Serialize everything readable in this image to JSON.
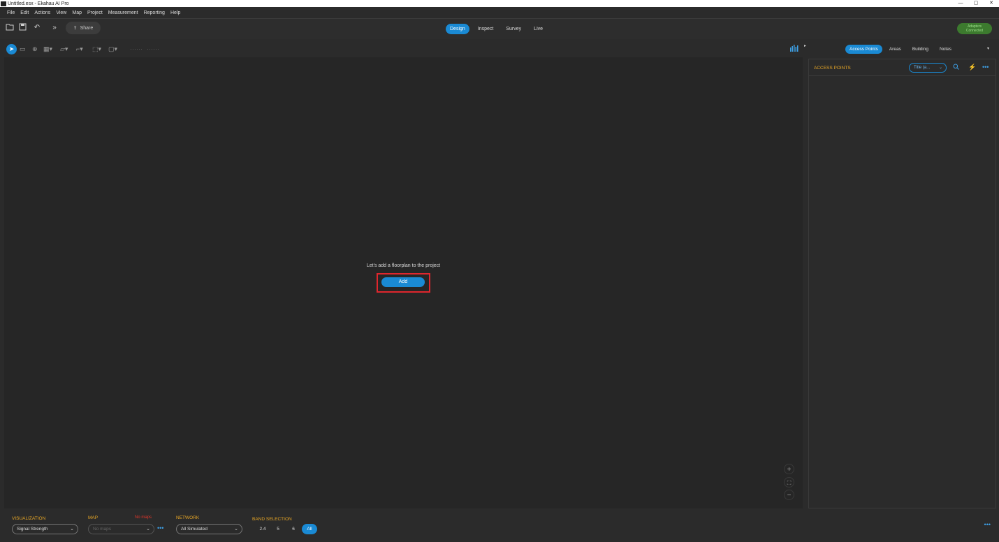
{
  "window": {
    "title": "Untitled.esx - Ekahau AI Pro",
    "minimize": "—",
    "maximize": "▢",
    "close": "✕"
  },
  "menu": [
    "File",
    "Edit",
    "Actions",
    "View",
    "Map",
    "Project",
    "Measurement",
    "Reporting",
    "Help"
  ],
  "toolbar": {
    "share_label": "Share"
  },
  "modes": [
    {
      "label": "Design",
      "active": true
    },
    {
      "label": "Inspect",
      "active": false
    },
    {
      "label": "Survey",
      "active": false
    },
    {
      "label": "Live",
      "active": false
    }
  ],
  "adapter_status": {
    "line1": "Adapters",
    "line2": "Connected"
  },
  "canvas": {
    "empty_message": "Let's add a floorplan to the project",
    "add_label": "Add"
  },
  "right_panel": {
    "tabs": [
      {
        "label": "Access Points",
        "active": true
      },
      {
        "label": "Areas",
        "active": false
      },
      {
        "label": "Building",
        "active": false
      },
      {
        "label": "Notes",
        "active": false
      }
    ],
    "title": "ACCESS POINTS",
    "sort_value": "Title (a..."
  },
  "bottom": {
    "visualization_label": "VISUALIZATION",
    "visualization_value": "Signal Strength",
    "map_label": "MAP",
    "map_warning": "No maps",
    "map_placeholder": "No maps",
    "network_label": "NETWORK",
    "network_value": "All Simulated",
    "band_label": "BAND SELECTION",
    "bands": [
      {
        "label": "2.4",
        "active": false
      },
      {
        "label": "5",
        "active": false
      },
      {
        "label": "6",
        "active": false
      },
      {
        "label": "All",
        "active": true
      }
    ]
  },
  "colors": {
    "accent": "#1a8ad4",
    "header_orange": "#e5a526",
    "warning_red": "#e0352b",
    "highlight_red": "#e0262d",
    "adapter_green": "#3c7a2e"
  }
}
